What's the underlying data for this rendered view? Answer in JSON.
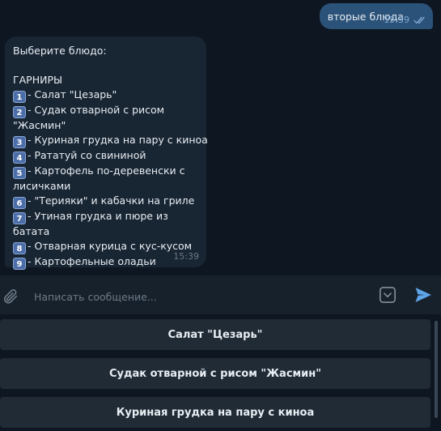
{
  "outgoing": {
    "text": "вторые блюда",
    "time": "15:39"
  },
  "incoming": {
    "prompt": "Выберите блюдо:",
    "section": "ГАРНИРЫ",
    "items": [
      {
        "num": "1",
        "lines": [
          "- Салат \"Цезарь\""
        ]
      },
      {
        "num": "2",
        "lines": [
          "- Судак отварной с рисом",
          "\"Жасмин\""
        ]
      },
      {
        "num": "3",
        "lines": [
          "- Куриная грудка на пару с киноа"
        ]
      },
      {
        "num": "4",
        "lines": [
          "- Рататуй со свининой"
        ]
      },
      {
        "num": "5",
        "lines": [
          "- Картофель по-деревенски с",
          "лисичками"
        ]
      },
      {
        "num": "6",
        "lines": [
          "- \"Терияки\" и кабачки на гриле"
        ]
      },
      {
        "num": "7",
        "lines": [
          "- Утиная грудка и пюре из",
          "батата"
        ]
      },
      {
        "num": "8",
        "lines": [
          "- Отварная курица с кус-кусом"
        ]
      },
      {
        "num": "9",
        "lines": [
          "- Картофельные оладьи"
        ]
      }
    ],
    "time": "15:39"
  },
  "composer": {
    "placeholder": "Написать сообщение..."
  },
  "keyboard": {
    "buttons": [
      "Салат \"Цезарь\"",
      "Судак отварной с рисом \"Жасмин\"",
      "Куриная грудка на пару с киноа"
    ]
  },
  "icons": {
    "attach": "paperclip-icon",
    "keyboard": "keyboard-toggle-icon",
    "send": "send-icon",
    "read": "double-check-icon"
  },
  "colors": {
    "background": "#0e1621",
    "outgoing_bubble": "#2b5278",
    "incoming_bubble": "#182533",
    "accent": "#5ea4e8",
    "keyboard_button": "#202b36"
  }
}
